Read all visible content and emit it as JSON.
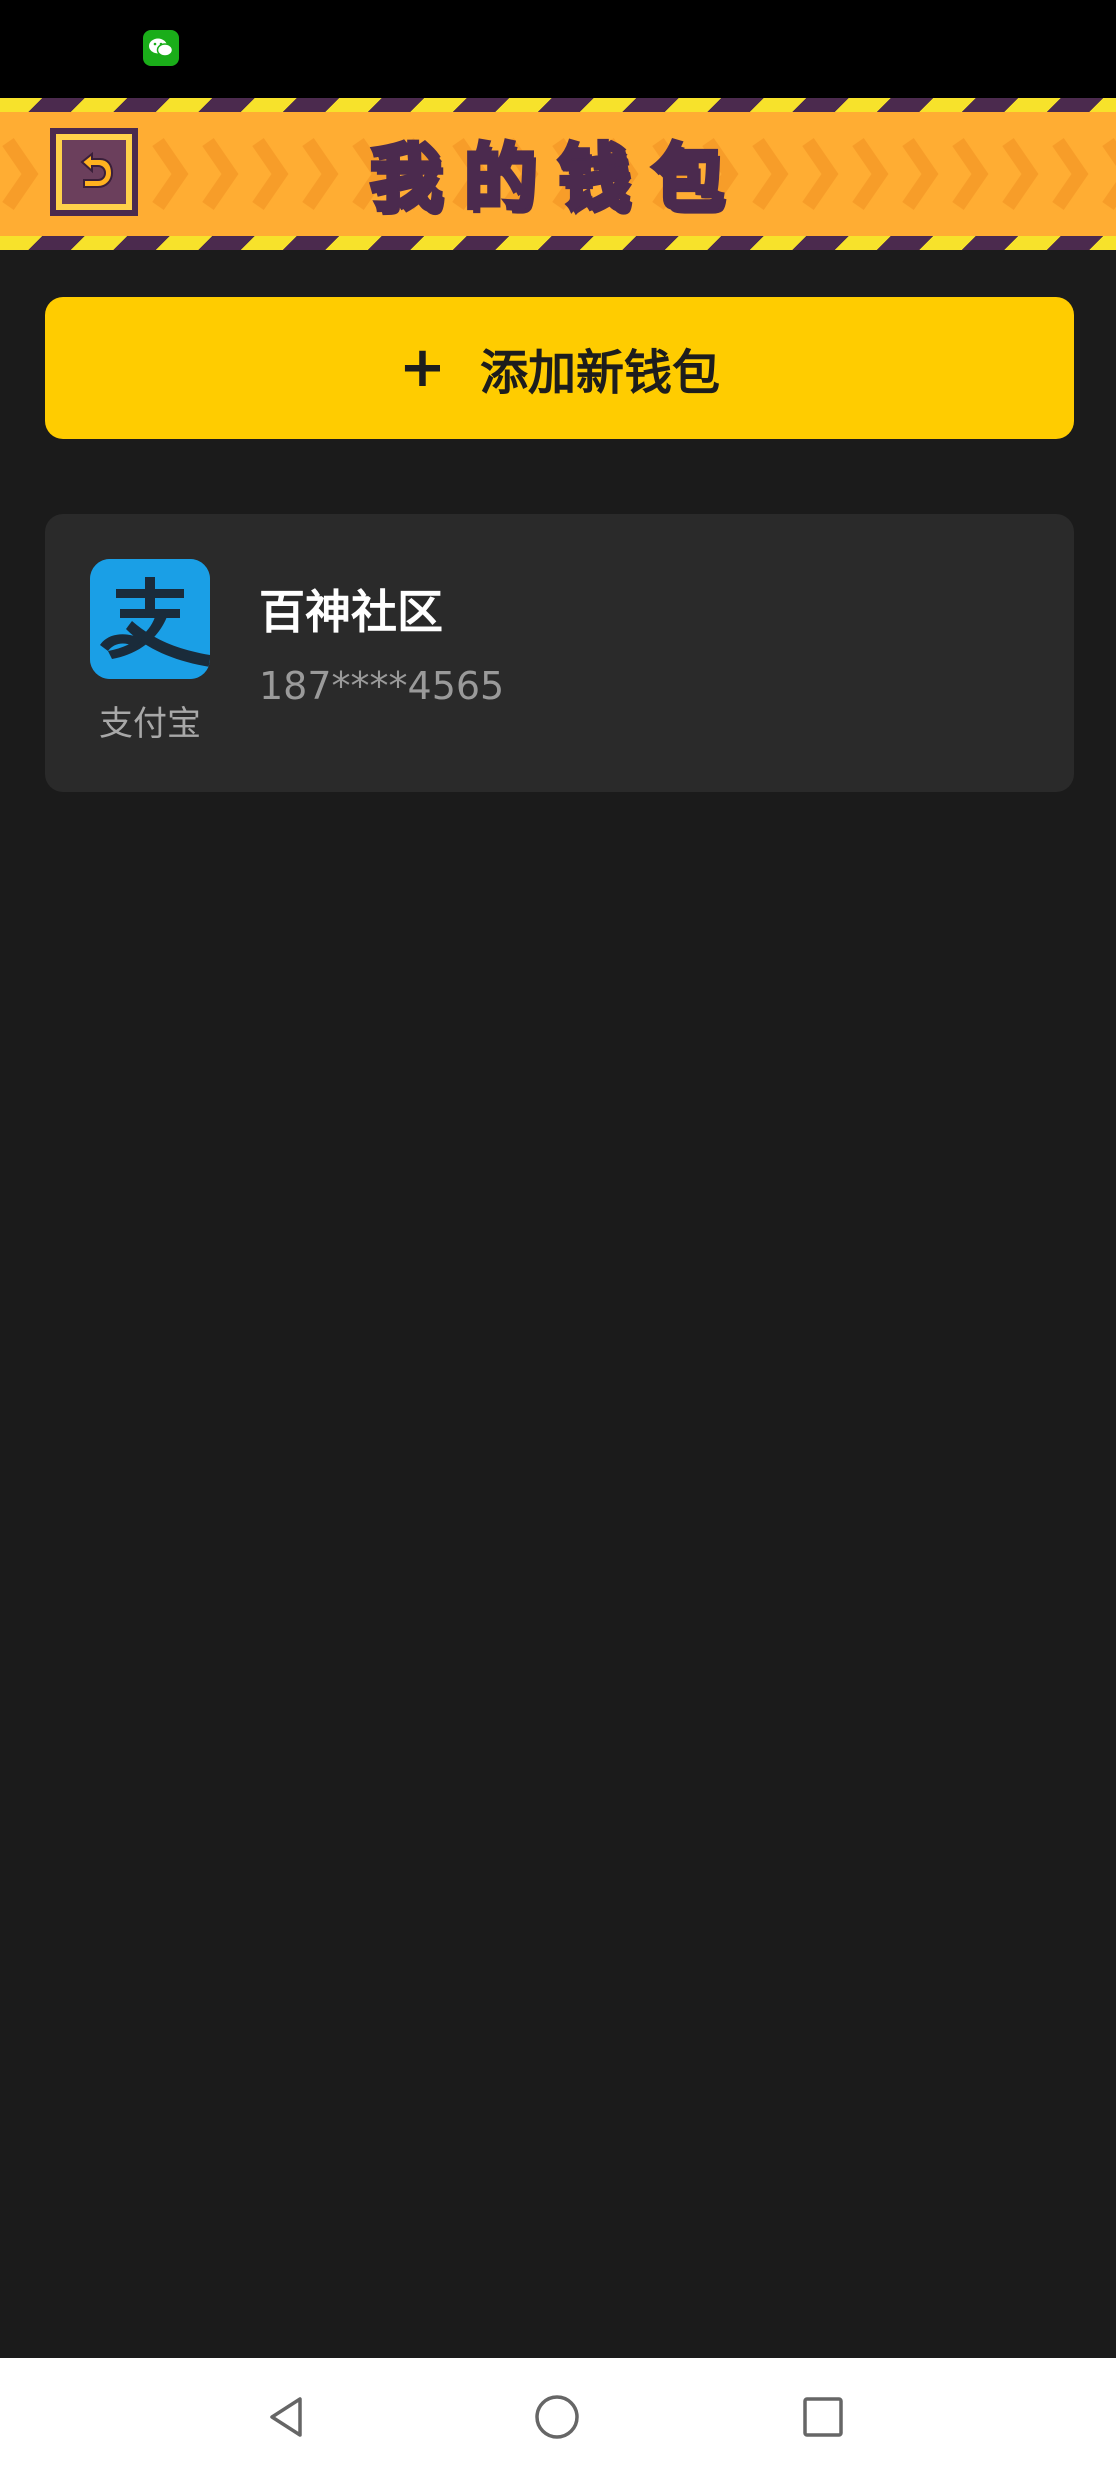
{
  "status_bar": {
    "notification_icons": [
      "wechat-icon"
    ]
  },
  "header": {
    "title": "我的钱包",
    "back_icon": "back-arrow-icon",
    "colors": {
      "background": "#ffad33",
      "title": "#f7f57a",
      "outline": "#4b2a4e",
      "stripe": "#f7e22b"
    }
  },
  "add_wallet": {
    "icon": "+",
    "label": "添加新钱包",
    "color": "#ffcc00"
  },
  "wallets": [
    {
      "provider_icon": "alipay-icon",
      "provider_label": "支付宝",
      "name": "百神社区",
      "account": "187****4565"
    }
  ],
  "nav_bar": {
    "items": [
      "back-triangle-icon",
      "home-circle-icon",
      "recent-square-icon"
    ]
  }
}
